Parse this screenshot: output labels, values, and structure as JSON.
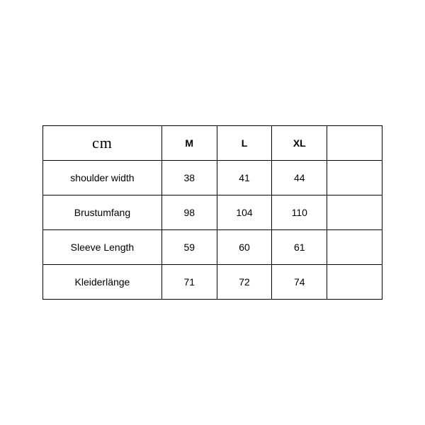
{
  "chart_data": {
    "type": "table",
    "unit_header": "cm",
    "columns": [
      "M",
      "L",
      "XL"
    ],
    "rows": [
      {
        "label": "shoulder width",
        "values": [
          38,
          41,
          44
        ]
      },
      {
        "label": "Brustumfang",
        "values": [
          98,
          104,
          110
        ]
      },
      {
        "label": "Sleeve Length",
        "values": [
          59,
          60,
          61
        ]
      },
      {
        "label": "Kleiderlänge",
        "values": [
          71,
          72,
          74
        ]
      }
    ]
  }
}
